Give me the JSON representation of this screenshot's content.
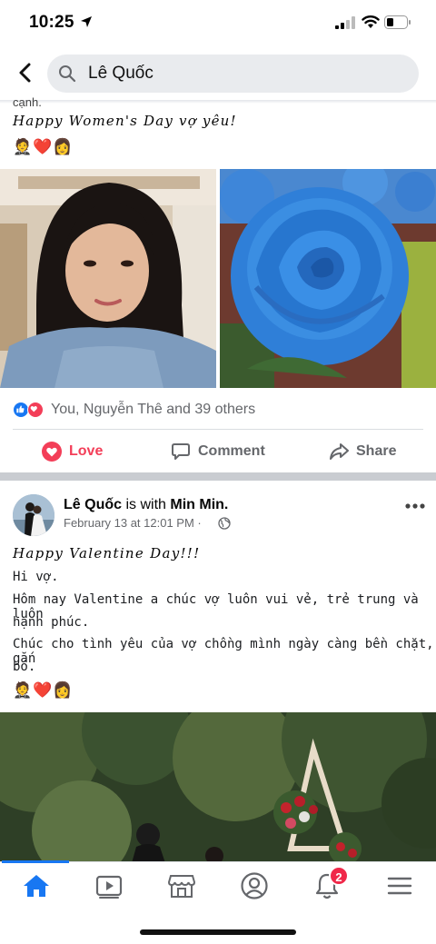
{
  "status_bar": {
    "time": "10:25"
  },
  "search": {
    "query": "Lê Quốc"
  },
  "post1": {
    "cut_text": "cạnh.",
    "line1": "Happy Women's Day vợ yêu!",
    "emoji_line": "🤵❤️👩",
    "reactions_text": "You, Nguyễn Thê and 39 others",
    "actions": {
      "love": "Love",
      "comment": "Comment",
      "share": "Share"
    }
  },
  "post2": {
    "author": "Lê Quốc",
    "with_text": "is with",
    "tagged": "Min Min.",
    "date": "February 13 at 12:01 PM · ",
    "title": "Happy Valentine Day!!!",
    "lines": [
      "Hi vợ.",
      "Hôm nay Valentine a chúc vợ luôn vui vẻ, trẻ trung và luôn",
      "hạnh phúc.",
      "Chúc cho tình yêu của vợ chồng mình ngày càng bền chặt, gắn",
      "bó."
    ],
    "emoji_line": "🤵❤️👩"
  },
  "bottom_nav": {
    "notifications_badge": "2",
    "items": [
      "home-icon",
      "watch-icon",
      "marketplace-icon",
      "profile-icon",
      "notifications-icon",
      "menu-icon"
    ]
  },
  "colors": {
    "accent": "#1877f2",
    "love": "#f33e58",
    "badge": "#f02849"
  }
}
